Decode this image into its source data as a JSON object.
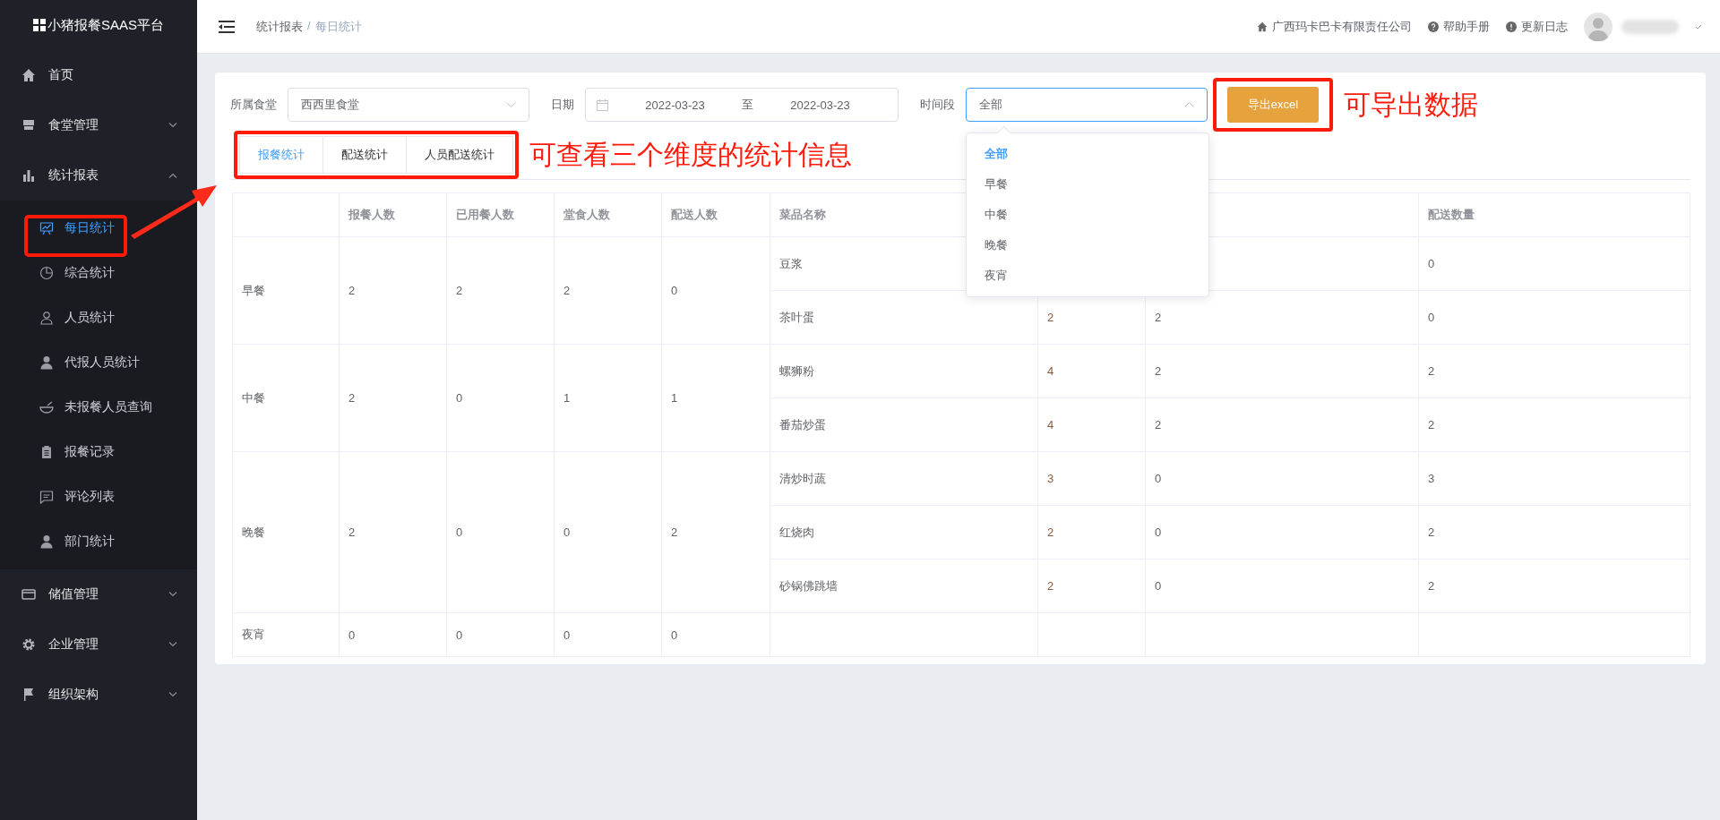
{
  "sidebar": {
    "logo": "小猪报餐SAAS平台",
    "items": [
      {
        "label": "首页",
        "kind": "link"
      },
      {
        "label": "食堂管理",
        "kind": "group",
        "expanded": false
      },
      {
        "label": "统计报表",
        "kind": "group",
        "expanded": true,
        "children": [
          {
            "label": "每日统计",
            "selected": true
          },
          {
            "label": "综合统计",
            "selected": false
          },
          {
            "label": "人员统计",
            "selected": false
          },
          {
            "label": "代报人员统计",
            "selected": false
          },
          {
            "label": "未报餐人员查询",
            "selected": false
          },
          {
            "label": "报餐记录",
            "selected": false
          },
          {
            "label": "评论列表",
            "selected": false
          },
          {
            "label": "部门统计",
            "selected": false
          }
        ]
      },
      {
        "label": "储值管理",
        "kind": "group",
        "expanded": false
      },
      {
        "label": "企业管理",
        "kind": "group",
        "expanded": false
      },
      {
        "label": "组织架构",
        "kind": "group",
        "expanded": false
      }
    ]
  },
  "header": {
    "breadcrumb": [
      "统计报表",
      "每日统计"
    ],
    "breadcrumb_separator": "/",
    "links": [
      "广西玛卡巴卡有限责任公司",
      "帮助手册",
      "更新日志"
    ]
  },
  "filters": {
    "canteen": {
      "label": "所属食堂",
      "value": "西西里食堂"
    },
    "date": {
      "label": "日期",
      "start": "2022-03-23",
      "separator": "至",
      "end": "2022-03-23"
    },
    "period": {
      "label": "时间段",
      "value": "全部",
      "expanded": true,
      "options": [
        {
          "label": "全部",
          "selected": true
        },
        {
          "label": "早餐",
          "selected": false
        },
        {
          "label": "中餐",
          "selected": false
        },
        {
          "label": "晚餐",
          "selected": false
        },
        {
          "label": "夜宵",
          "selected": false
        }
      ]
    },
    "export_button": "导出excel"
  },
  "tabs": [
    {
      "label": "报餐统计",
      "selected": true
    },
    {
      "label": "配送统计",
      "selected": false
    },
    {
      "label": "人员配送统计",
      "selected": false
    }
  ],
  "table": {
    "columns": [
      "报餐人数",
      "已用餐人数",
      "堂食人数",
      "配送人数",
      "菜品名称",
      "配送数量"
    ],
    "rows": [
      {
        "meal": "早餐",
        "counts": [
          "2",
          "2",
          "2",
          "0"
        ],
        "dishes": [
          {
            "name": "豆浆",
            "delivery": "0"
          },
          {
            "name": "茶叶蛋",
            "column_7": "2",
            "column_8": "2",
            "delivery": "0"
          }
        ]
      },
      {
        "meal": "中餐",
        "counts": [
          "2",
          "0",
          "1",
          "1"
        ],
        "dishes": [
          {
            "name": "螺狮粉",
            "column_7": "4",
            "column_8": "2",
            "delivery": "2"
          },
          {
            "name": "番茄炒蛋",
            "column_7": "4",
            "column_8": "2",
            "delivery": "2"
          }
        ]
      },
      {
        "meal": "晚餐",
        "counts": [
          "2",
          "0",
          "0",
          "2"
        ],
        "dishes": [
          {
            "name": "清炒时蔬",
            "column_7": "3",
            "column_8": "0",
            "delivery": "3"
          },
          {
            "name": "红烧肉",
            "column_7": "2",
            "column_8": "0",
            "delivery": "2"
          },
          {
            "name": "砂锅佛跳墙",
            "column_7": "2",
            "column_8": "0",
            "delivery": "2"
          }
        ]
      },
      {
        "meal": "夜宵",
        "counts": [
          "0",
          "0",
          "0",
          "0"
        ]
      }
    ]
  },
  "annotations": [
    "可查看三个维度的统计信息",
    "可导出数据"
  ]
}
